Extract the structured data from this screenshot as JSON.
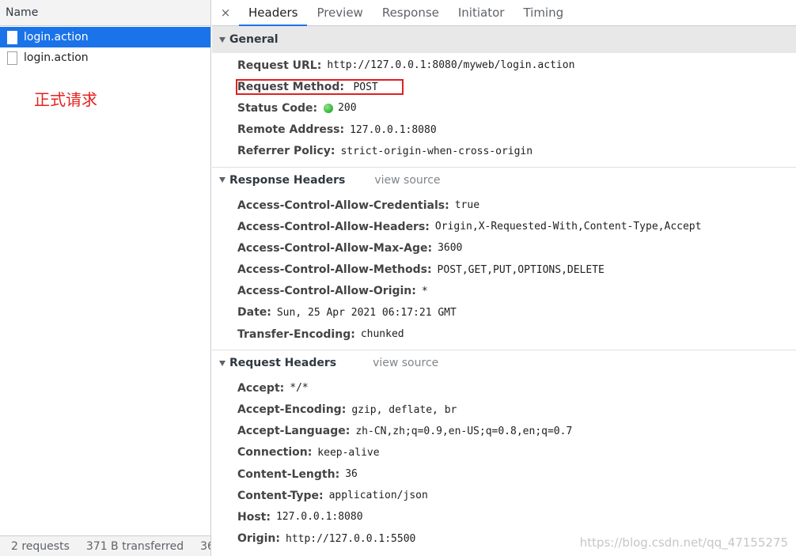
{
  "left_panel": {
    "header": "Name",
    "requests": [
      {
        "name": "login.action",
        "selected": true
      },
      {
        "name": "login.action",
        "selected": false
      }
    ],
    "annotation": "正式请求",
    "footer": {
      "requests": "2 requests",
      "transferred": "371 B transferred",
      "extra": "36"
    }
  },
  "tabs": {
    "close": "×",
    "items": [
      "Headers",
      "Preview",
      "Response",
      "Initiator",
      "Timing"
    ],
    "active": "Headers"
  },
  "general": {
    "title": "General",
    "rows": [
      {
        "key": "Request URL:",
        "value": "http://127.0.0.1:8080/myweb/login.action"
      },
      {
        "key": "Request Method:",
        "value": "POST"
      },
      {
        "key": "Status Code:",
        "value": "200"
      },
      {
        "key": "Remote Address:",
        "value": "127.0.0.1:8080"
      },
      {
        "key": "Referrer Policy:",
        "value": "strict-origin-when-cross-origin"
      }
    ]
  },
  "response_headers": {
    "title": "Response Headers",
    "view_source": "view source",
    "rows": [
      {
        "key": "Access-Control-Allow-Credentials:",
        "value": "true"
      },
      {
        "key": "Access-Control-Allow-Headers:",
        "value": "Origin,X-Requested-With,Content-Type,Accept"
      },
      {
        "key": "Access-Control-Allow-Max-Age:",
        "value": "3600"
      },
      {
        "key": "Access-Control-Allow-Methods:",
        "value": "POST,GET,PUT,OPTIONS,DELETE"
      },
      {
        "key": "Access-Control-Allow-Origin:",
        "value": "*"
      },
      {
        "key": "Date:",
        "value": "Sun, 25 Apr 2021 06:17:21 GMT"
      },
      {
        "key": "Transfer-Encoding:",
        "value": "chunked"
      }
    ]
  },
  "request_headers": {
    "title": "Request Headers",
    "view_source": "view source",
    "rows": [
      {
        "key": "Accept:",
        "value": "*/*"
      },
      {
        "key": "Accept-Encoding:",
        "value": "gzip, deflate, br"
      },
      {
        "key": "Accept-Language:",
        "value": "zh-CN,zh;q=0.9,en-US;q=0.8,en;q=0.7"
      },
      {
        "key": "Connection:",
        "value": "keep-alive"
      },
      {
        "key": "Content-Length:",
        "value": "36"
      },
      {
        "key": "Content-Type:",
        "value": "application/json"
      },
      {
        "key": "Host:",
        "value": "127.0.0.1:8080"
      },
      {
        "key": "Origin:",
        "value": "http://127.0.0.1:5500"
      }
    ]
  },
  "watermark": "https://blog.csdn.net/qq_47155275",
  "colors": {
    "accent": "#1a73e8",
    "annotation": "#e82020",
    "status_ok": "#0a9a0a"
  }
}
